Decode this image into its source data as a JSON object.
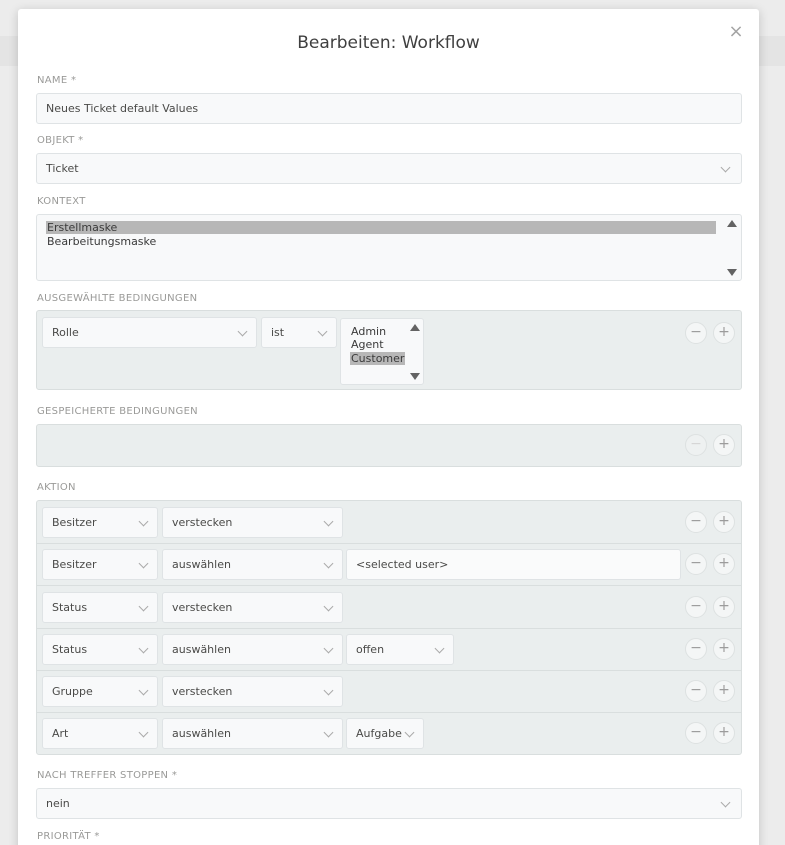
{
  "modal": {
    "title": "Bearbeiten: Workflow",
    "close_icon": "×"
  },
  "fields": {
    "name_label": "Name *",
    "name_value": "Neues Ticket default Values",
    "object_label": "Objekt *",
    "object_value": "Ticket",
    "context_label": "Kontext",
    "context_options": [
      {
        "label": "Erstellmaske",
        "selected": true
      },
      {
        "label": "Bearbeitungsmaske",
        "selected": false
      }
    ],
    "selected_conditions_label": "Ausgewählte Bedingungen",
    "condition": {
      "attribute": "Rolle",
      "operator": "ist",
      "values": [
        {
          "label": "Admin",
          "selected": false
        },
        {
          "label": "Agent",
          "selected": false
        },
        {
          "label": "Customer",
          "selected": true
        }
      ]
    },
    "saved_conditions_label": "Gespeicherte Bedingungen",
    "action_label": "Aktion",
    "actions": [
      {
        "attribute": "Besitzer",
        "operation": "verstecken",
        "value": null
      },
      {
        "attribute": "Besitzer",
        "operation": "auswählen",
        "value": "<selected user>"
      },
      {
        "attribute": "Status",
        "operation": "verstecken",
        "value": null
      },
      {
        "attribute": "Status",
        "operation": "auswählen",
        "value": "offen"
      },
      {
        "attribute": "Gruppe",
        "operation": "verstecken",
        "value": null
      },
      {
        "attribute": "Art",
        "operation": "auswählen",
        "value": "Aufgabe"
      }
    ],
    "stop_label": "Nach Treffer stoppen *",
    "stop_value": "nein",
    "priority_label": "Priorität *"
  },
  "icons": {
    "minus": "−",
    "plus": "+"
  }
}
